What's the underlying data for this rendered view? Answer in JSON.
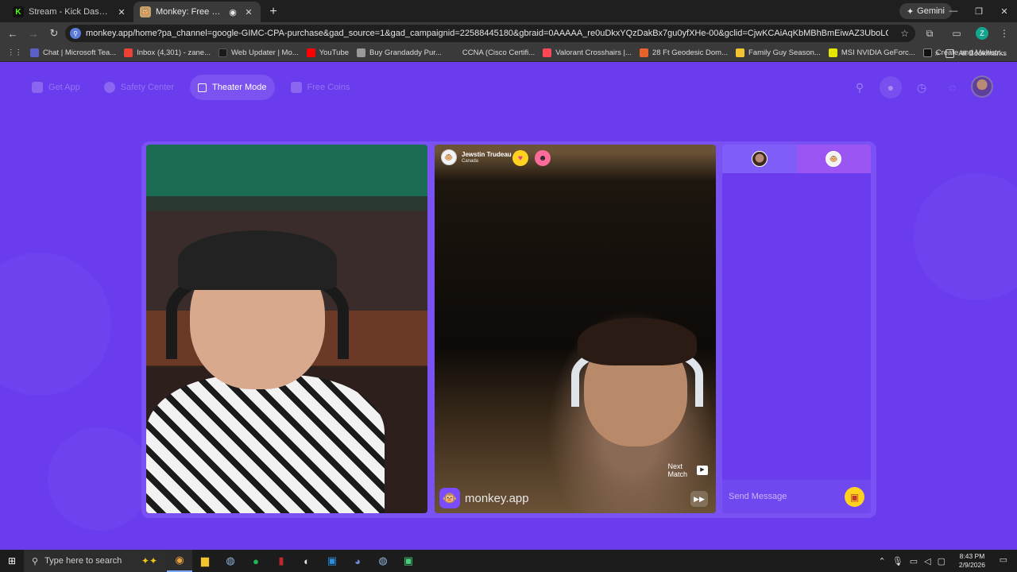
{
  "browser": {
    "tabs": [
      {
        "title": "Stream - Kick Dashboard",
        "active": false,
        "favicon": "kick-icon",
        "favicon_color": "#53fc18"
      },
      {
        "title": "Monkey: Free Live Video Ch",
        "active": true,
        "favicon": "monkey-icon",
        "favicon_color": "#8a5cff"
      }
    ],
    "gemini_label": "Gemini",
    "url": "monkey.app/home?pa_channel=google-GIMC-CPA-purchase&gad_source=1&gad_campaignid=22588445180&gbraid=0AAAAA_re0uDkxYQzDakBx7gu0yfXHe-00&gclid=CjwKCAiAqKbMBhBmEiwAZ3UboLOQt9nwM3MD9tKHJA2aDx7LWBnmmtfL...",
    "profile_initial": "Z",
    "bookmarks": [
      {
        "label": "Chat | Microsoft Tea...",
        "color": "#5b5fc7"
      },
      {
        "label": "Inbox (4,301) - zane...",
        "color": "#ea4335"
      },
      {
        "label": "Web Updater | Mo...",
        "color": "#1a1a1a"
      },
      {
        "label": "YouTube",
        "color": "#ff0000"
      },
      {
        "label": "Buy Grandaddy Pur...",
        "color": "#9a9a9a"
      },
      {
        "label": "CCNA (Cisco Certifi...",
        "color": "#3a3a3a"
      },
      {
        "label": "Valorant Crosshairs |...",
        "color": "#ff4655"
      },
      {
        "label": "28 Ft Geodesic Dom...",
        "color": "#e8632b"
      },
      {
        "label": "Family Guy Season...",
        "color": "#f4c430"
      },
      {
        "label": "MSI NVIDIA GeForc...",
        "color": "#e6e600"
      },
      {
        "label": "Create and Multistr...",
        "color": "#111111"
      }
    ],
    "all_bookmarks_label": "All Bookmarks"
  },
  "app": {
    "nav": [
      {
        "label": "Get App",
        "active": false
      },
      {
        "label": "Safety Center",
        "active": false
      },
      {
        "label": "Theater Mode",
        "active": true
      },
      {
        "label": "Free Coins",
        "active": false
      }
    ],
    "accent": "#6a3cee",
    "remote_user": {
      "name": "Jewstin Trudeau",
      "country": "Canada"
    },
    "brand_text": "monkey.app",
    "next_match_line1": "Next",
    "next_match_line2": "Match",
    "chat_placeholder": "Send Message"
  },
  "taskbar": {
    "search_placeholder": "Type here to search",
    "time": "8:43 PM",
    "date": "2/9/2026"
  }
}
